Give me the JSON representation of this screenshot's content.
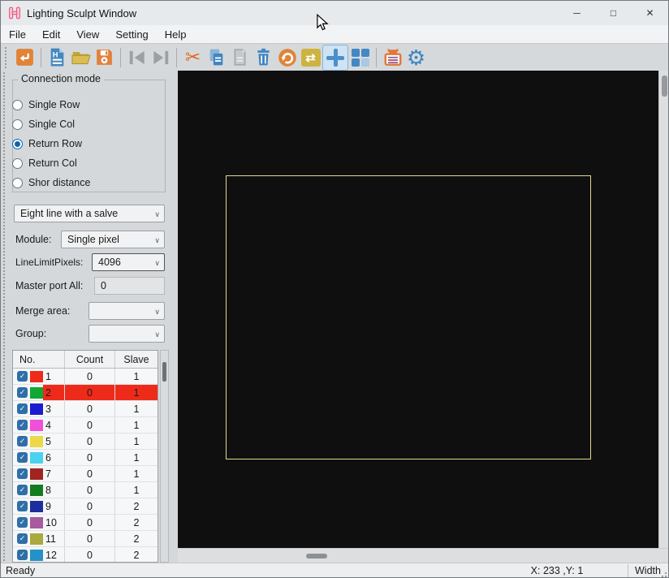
{
  "window": {
    "title": "Lighting Sculpt Window",
    "minimize": "─",
    "maximize": "□",
    "close": "✕"
  },
  "menu": {
    "items": [
      "File",
      "Edit",
      "View",
      "Setting",
      "Help"
    ]
  },
  "toolbar": {
    "active": "crosshair-tool",
    "items": [
      {
        "name": "import"
      },
      {
        "name": "new-hex-file"
      },
      {
        "name": "open-file"
      },
      {
        "name": "save-file"
      },
      {
        "name": "skip-first"
      },
      {
        "name": "skip-last"
      },
      {
        "name": "cut"
      },
      {
        "name": "copy"
      },
      {
        "name": "paste"
      },
      {
        "name": "delete"
      },
      {
        "name": "rotate"
      },
      {
        "name": "swap"
      },
      {
        "name": "crosshair-tool"
      },
      {
        "name": "layout-grid"
      },
      {
        "name": "device-config"
      },
      {
        "name": "settings"
      }
    ]
  },
  "glyphs": {
    "cut": "✂",
    "swap": "⇄",
    "gear": "⚙",
    "check": "✓",
    "chevron": "∨"
  },
  "panel": {
    "connection_mode": {
      "title": "Connection mode",
      "options": [
        {
          "label": "Single Row",
          "selected": false,
          "dot": "transparent"
        },
        {
          "label": "Single Col",
          "selected": false,
          "dot": "transparent"
        },
        {
          "label": "Return Row",
          "selected": true,
          "dot": "#0e63ae"
        },
        {
          "label": "Return Col",
          "selected": false,
          "dot": "transparent"
        },
        {
          "label": "Shor distance",
          "selected": false,
          "dot": "transparent"
        }
      ]
    },
    "line_type": {
      "value": "Eight line with a salve"
    },
    "module": {
      "label": "Module:",
      "value": "Single pixel"
    },
    "line_limit": {
      "label": "LineLimitPixels:",
      "value": "4096"
    },
    "master_port": {
      "label": "Master port All:",
      "value": "0"
    },
    "merge_area": {
      "label": "Merge area:",
      "value": ""
    },
    "group": {
      "label": "Group:",
      "value": ""
    },
    "table": {
      "headers": [
        "No.",
        "Count",
        "Slave"
      ],
      "rows": [
        {
          "no": "1",
          "count": "0",
          "slave": "1",
          "color": "#ee2b1a",
          "checked": true,
          "row_bg": "transparent"
        },
        {
          "no": "2",
          "count": "0",
          "slave": "1",
          "color": "#0ea832",
          "checked": true,
          "row_bg": "#ee2b1a"
        },
        {
          "no": "3",
          "count": "0",
          "slave": "1",
          "color": "#1b1bd0",
          "checked": true,
          "row_bg": "transparent"
        },
        {
          "no": "4",
          "count": "0",
          "slave": "1",
          "color": "#f050d8",
          "checked": true,
          "row_bg": "transparent"
        },
        {
          "no": "5",
          "count": "0",
          "slave": "1",
          "color": "#ecd94a",
          "checked": true,
          "row_bg": "transparent"
        },
        {
          "no": "6",
          "count": "0",
          "slave": "1",
          "color": "#4cd2f0",
          "checked": true,
          "row_bg": "transparent"
        },
        {
          "no": "7",
          "count": "0",
          "slave": "1",
          "color": "#a02420",
          "checked": true,
          "row_bg": "transparent"
        },
        {
          "no": "8",
          "count": "0",
          "slave": "1",
          "color": "#137c1e",
          "checked": true,
          "row_bg": "transparent"
        },
        {
          "no": "9",
          "count": "0",
          "slave": "2",
          "color": "#1c2e9e",
          "checked": true,
          "row_bg": "transparent"
        },
        {
          "no": "10",
          "count": "0",
          "slave": "2",
          "color": "#a85a9e",
          "checked": true,
          "row_bg": "transparent"
        },
        {
          "no": "11",
          "count": "0",
          "slave": "2",
          "color": "#a9a93e",
          "checked": true,
          "row_bg": "transparent"
        },
        {
          "no": "12",
          "count": "0",
          "slave": "2",
          "color": "#2492c8",
          "checked": true,
          "row_bg": "transparent"
        }
      ]
    }
  },
  "statusbar": {
    "ready": "Ready",
    "coords": "X: 233 ,Y: 1",
    "width_label": "Width"
  },
  "colors": {
    "accent_blue": "#3d85c0",
    "accent_orange": "#e08438",
    "folder_khaki": "#d2b44e",
    "checkbox_blue": "#2e6fa8",
    "selection_red": "#ee2b1a",
    "canvas_bg": "#0f0f10",
    "wire_yellow": "#e5d88b",
    "grid_dark": "#4388c4",
    "grid_light": "#a6c9e4"
  }
}
